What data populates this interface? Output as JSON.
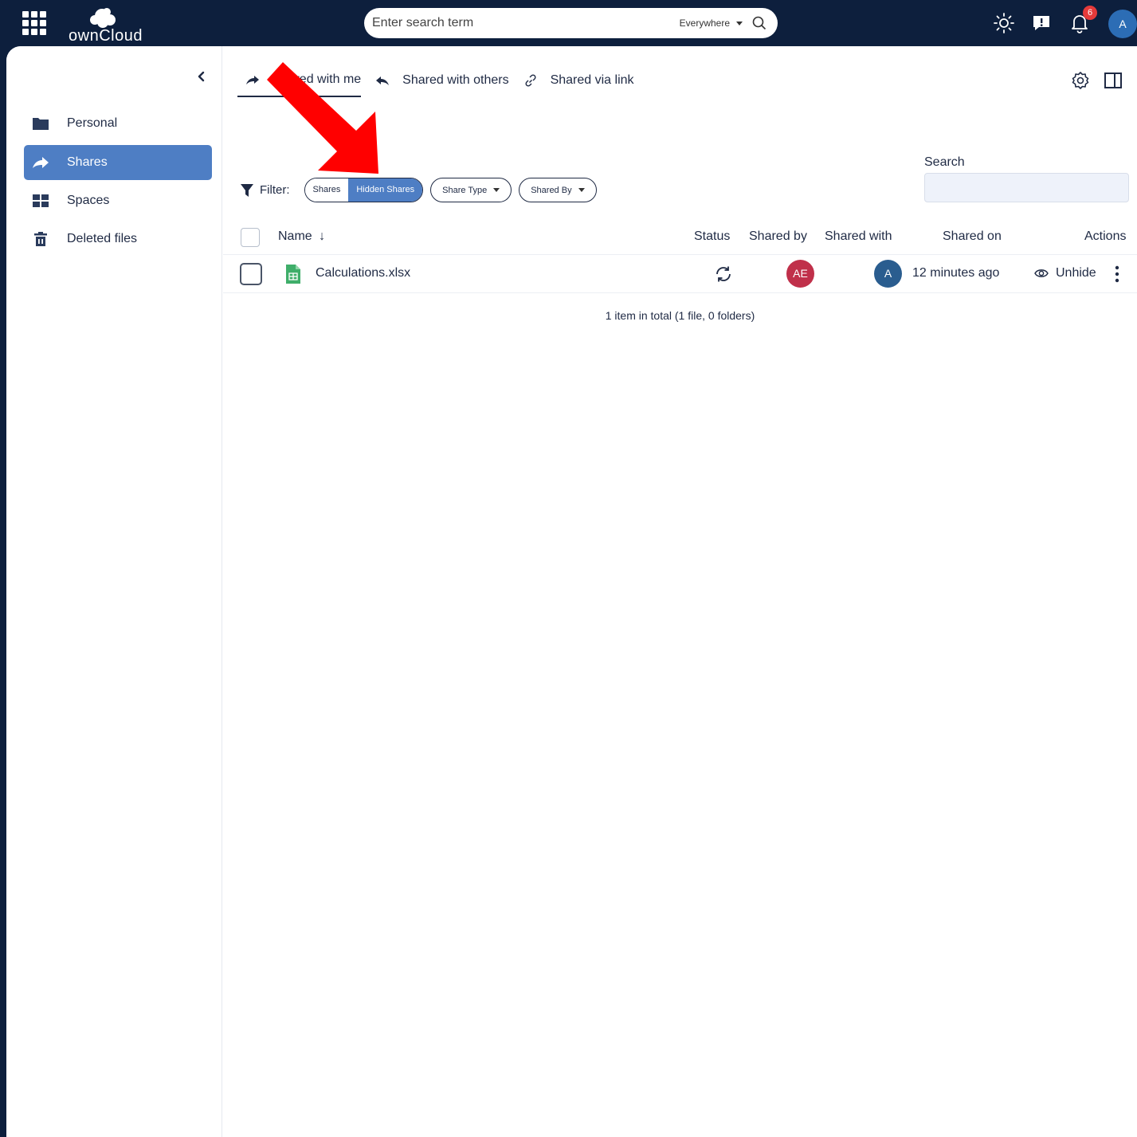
{
  "header": {
    "logo_text": "ownCloud",
    "search": {
      "placeholder": "Enter search term",
      "scope": "Everywhere"
    },
    "notifications_count": "6",
    "user_initial": "A"
  },
  "sidebar": {
    "items": [
      {
        "label": "Personal",
        "icon": "folder-icon",
        "active": false
      },
      {
        "label": "Shares",
        "icon": "share-icon",
        "active": true
      },
      {
        "label": "Spaces",
        "icon": "grid-icon",
        "active": false
      },
      {
        "label": "Deleted files",
        "icon": "trash-icon",
        "active": false
      }
    ]
  },
  "tabs": [
    {
      "label": "Shared with me",
      "icon": "share-arrow-icon",
      "active": true
    },
    {
      "label": "Shared with others",
      "icon": "reply-arrow-icon",
      "active": false
    },
    {
      "label": "Shared via link",
      "icon": "link-icon",
      "active": false
    }
  ],
  "filter": {
    "label": "Filter:",
    "segments": [
      "Shares",
      "Hidden Shares"
    ],
    "active_segment": "Hidden Shares",
    "share_type": "Share Type",
    "shared_by": "Shared By"
  },
  "search_panel": {
    "label": "Search"
  },
  "table": {
    "columns": {
      "name": "Name",
      "status": "Status",
      "shared_by": "Shared by",
      "shared_with": "Shared with",
      "shared_on": "Shared on",
      "actions": "Actions"
    },
    "rows": [
      {
        "name": "Calculations.xlsx",
        "file_icon": "spreadsheet-icon",
        "status_icon": "sync-icon",
        "shared_by_initials": "AE",
        "shared_with_initials": "A",
        "shared_on": "12 minutes ago",
        "action_label": "Unhide"
      }
    ],
    "footer": "1 item in total (1 file, 0 folders)"
  },
  "colors": {
    "topbar": "#0d1f3d",
    "accent": "#4e7ec4",
    "avatar_ae": "#c0304a",
    "avatar_a": "#2a5d8f",
    "annotation_arrow": "#ff0000"
  }
}
